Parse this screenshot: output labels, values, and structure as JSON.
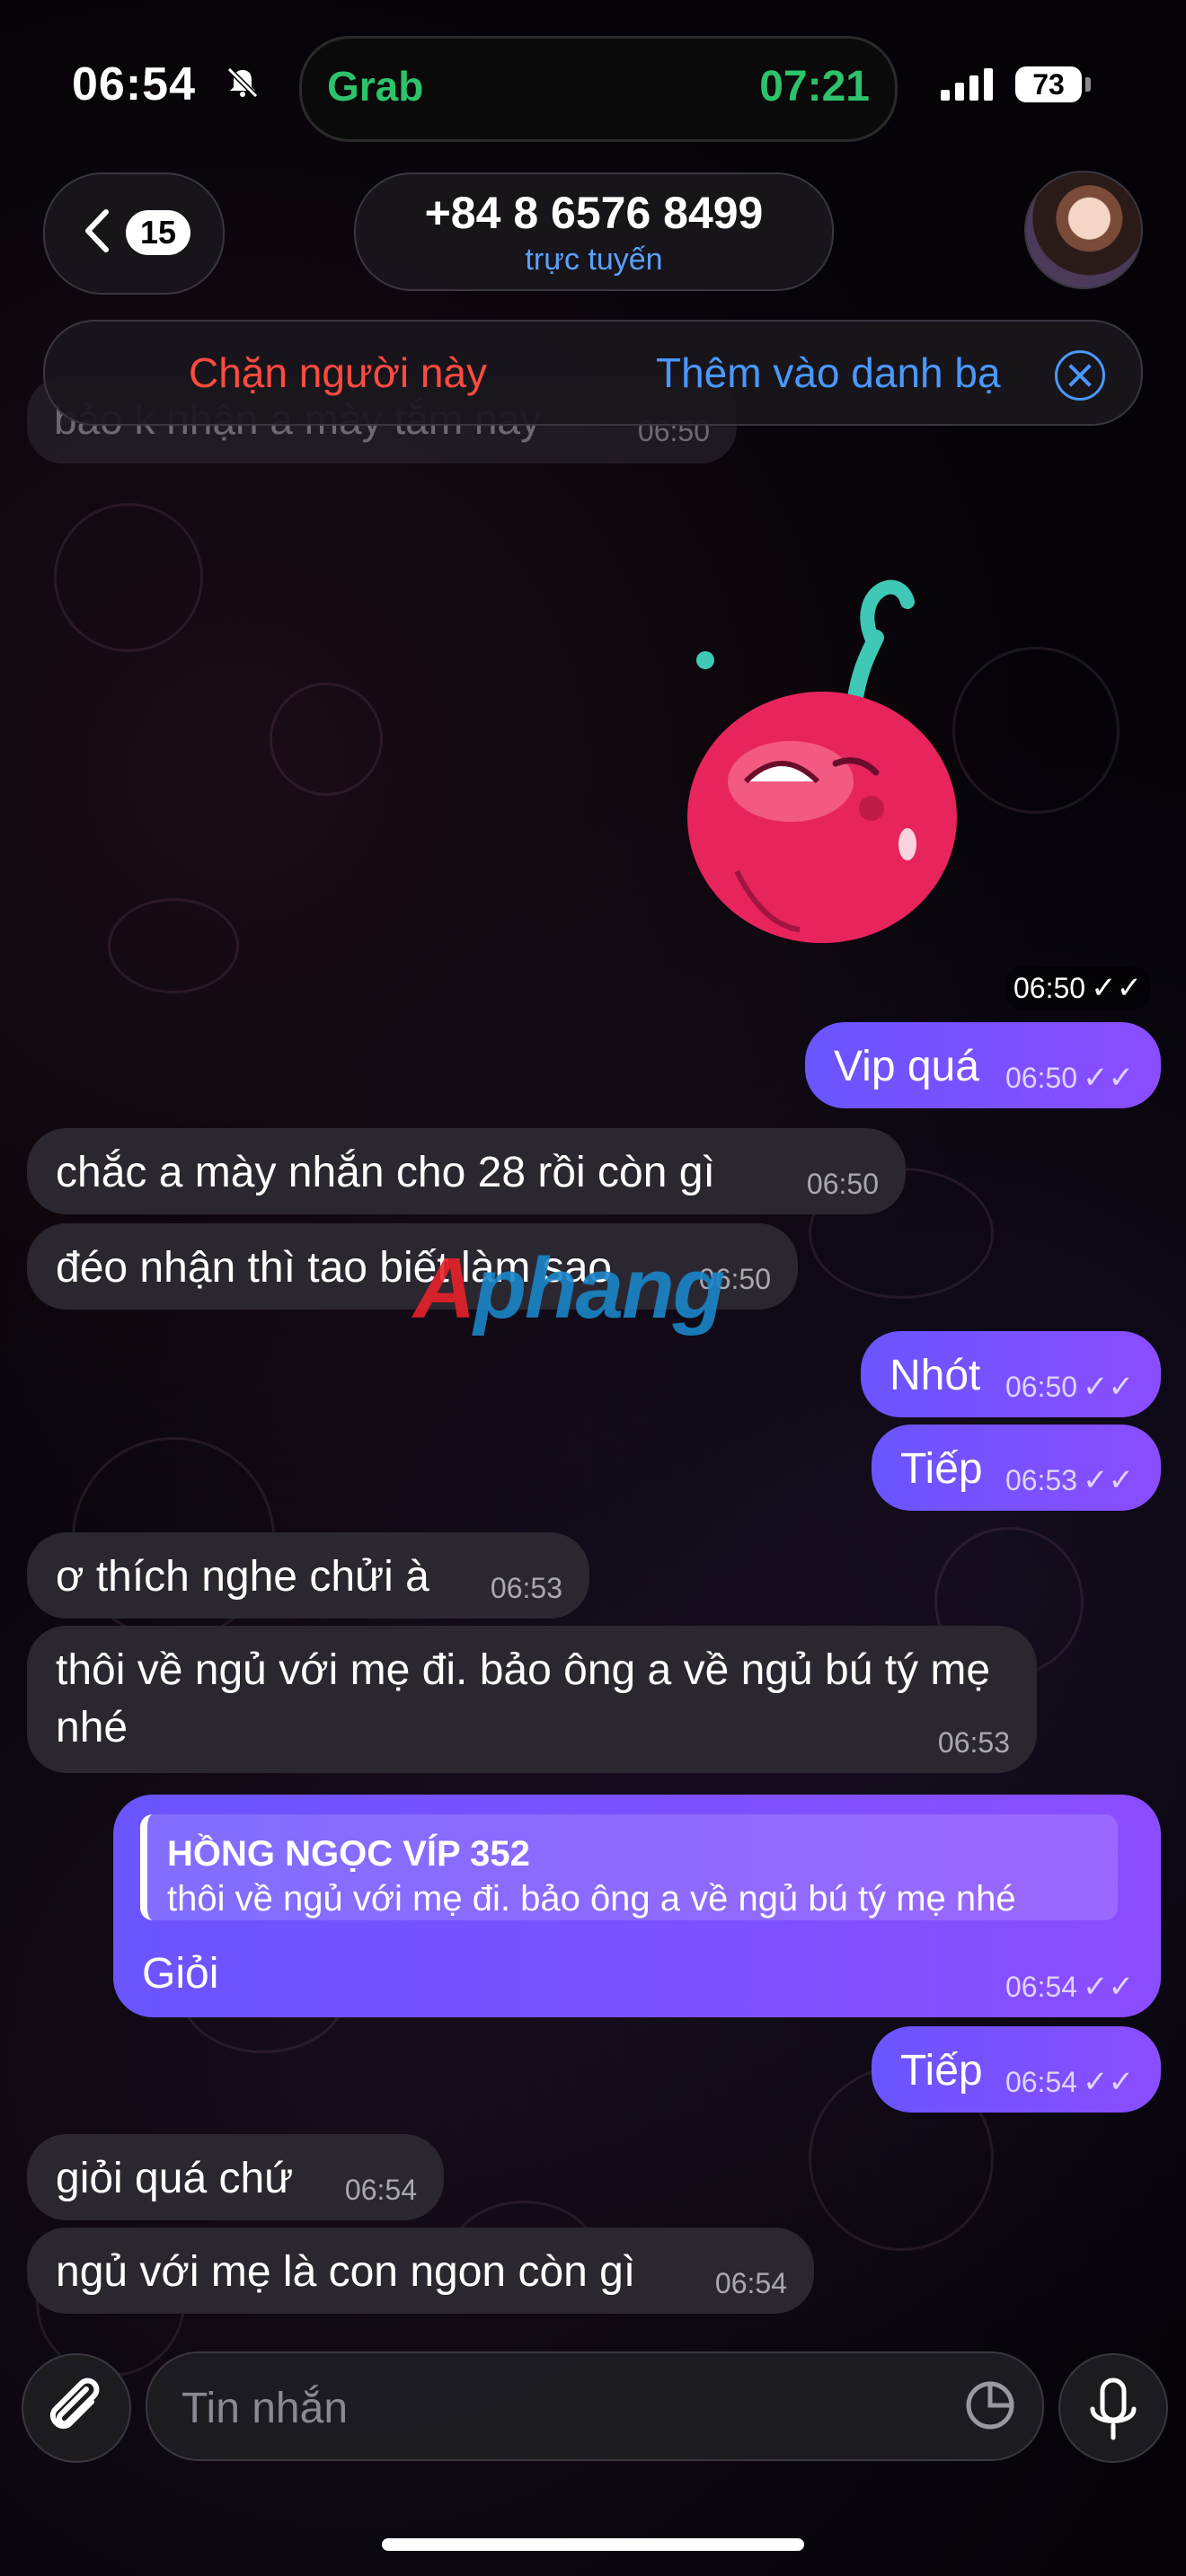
{
  "status_bar": {
    "time": "06:54",
    "island_app": "Grab",
    "island_time": "07:21",
    "battery": "73"
  },
  "header": {
    "back_count": "15",
    "contact_name": "+84 8 6576 8499",
    "contact_status": "trực tuyến"
  },
  "actions": {
    "block": "Chặn người này",
    "add_contact": "Thêm vào danh bạ"
  },
  "ghost_message": {
    "text": "bảo k nhận a mày tắm nay",
    "time": "06:50"
  },
  "sticker_time": "06:50",
  "messages": [
    {
      "dir": "out",
      "text": "Vip quá",
      "time": "06:50"
    },
    {
      "dir": "in",
      "text": "chắc a mày nhắn cho 28 rồi còn gì",
      "time": "06:50"
    },
    {
      "dir": "in",
      "text": "đéo nhận thì tao biết làm sao",
      "time": "06:50"
    },
    {
      "dir": "out",
      "text": "Nhót",
      "time": "06:50"
    },
    {
      "dir": "out",
      "text": "Tiếp",
      "time": "06:53"
    },
    {
      "dir": "in",
      "text": "ơ thích nghe chửi à",
      "time": "06:53"
    },
    {
      "dir": "in",
      "text": "thôi về ngủ với mẹ đi. bảo ông a về ngủ bú tý mẹ nhé",
      "time": "06:53"
    },
    {
      "dir": "out",
      "text": "Giỏi",
      "time": "06:54",
      "reply_name": "HỒNG NGỌC VÍP 352",
      "reply_text": "thôi về ngủ với mẹ đi. bảo ông a về ngủ bú tý mẹ nhé"
    },
    {
      "dir": "out",
      "text": "Tiếp",
      "time": "06:54"
    },
    {
      "dir": "in",
      "text": "giỏi quá chứ",
      "time": "06:54"
    },
    {
      "dir": "in",
      "text": "ngủ với mẹ là con ngon còn gì",
      "time": "06:54"
    }
  ],
  "watermark": {
    "part1": "A",
    "part2": "phang"
  },
  "composer": {
    "placeholder": "Tin nhắn"
  }
}
